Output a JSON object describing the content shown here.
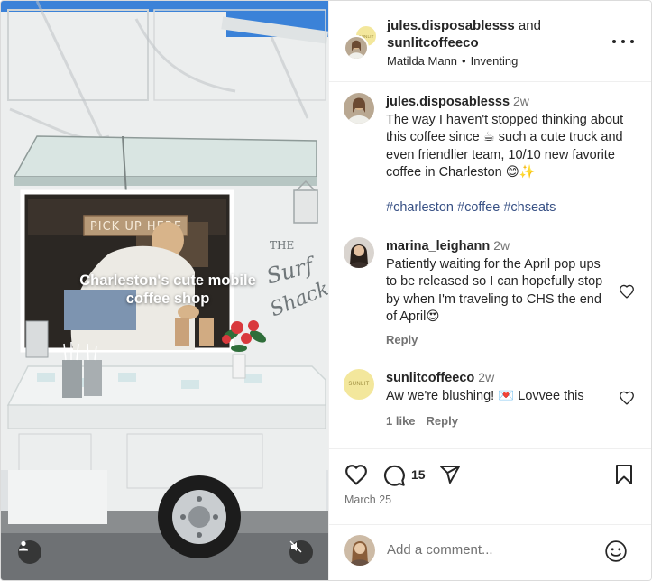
{
  "media": {
    "caption": "Charleston's cute mobile coffee shop",
    "sign_text": "PICK UP HERE",
    "truck_brand_line1": "THE",
    "truck_brand_line2": "Surf",
    "truck_brand_line3": "Shack"
  },
  "header": {
    "author1": "jules.disposablesss",
    "conjunction": "and",
    "author2": "sunlitcoffeeco",
    "music_artist": "Matilda Mann",
    "music_song": "Inventing",
    "coauthor_avatar_text": "SUNLIT"
  },
  "caption_comment": {
    "username": "jules.disposablesss",
    "time": "2w",
    "text": "The way I haven't stopped thinking about this coffee since ☕ such a cute truck and even friendlier team, 10/10 new favorite coffee in Charleston 😊✨",
    "hashtags": [
      "#charleston",
      "#coffee",
      "#chseats"
    ]
  },
  "comments": [
    {
      "username": "marina_leighann",
      "time": "2w",
      "text": "Patiently waiting for the April pop ups to be released so I can hopefully stop by when I'm traveling to CHS the end of April😍",
      "likes": "",
      "reply": "Reply"
    },
    {
      "username": "sunlitcoffeeco",
      "time": "2w",
      "text": "Aw we're blushing! 💌 Lovvee this",
      "likes": "1 like",
      "reply": "Reply",
      "avatar_text": "SUNLIT"
    }
  ],
  "actions": {
    "comment_count": "15",
    "date": "March 25"
  },
  "add_comment": {
    "placeholder": "Add a comment..."
  },
  "colors": {
    "hashtag": "#385185",
    "secondary_text": "#737373",
    "sunlit_yellow": "#f3e79c"
  }
}
